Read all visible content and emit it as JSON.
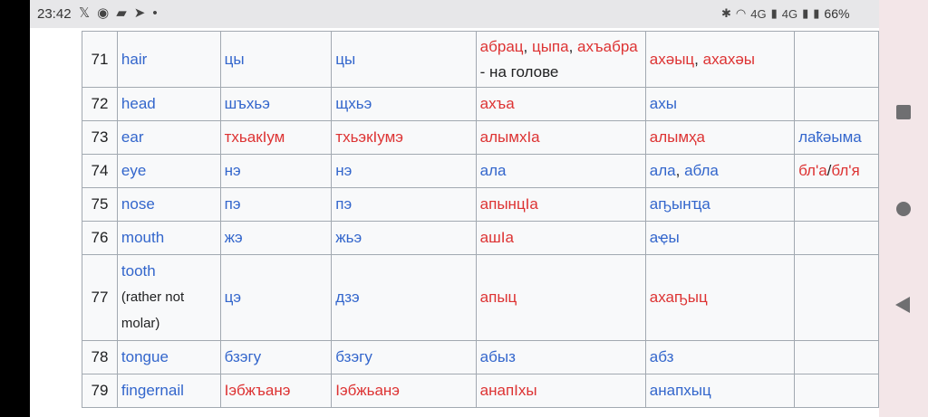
{
  "status": {
    "time": "23:42",
    "left_icons": [
      "x-icon",
      "telegram-icon",
      "chat-icon",
      "send-icon",
      "dot-icon"
    ],
    "battery": "66%",
    "net1": "4G",
    "net2": "4G"
  },
  "table": {
    "rows": [
      {
        "num": "71",
        "english": "hair",
        "c2": [
          {
            "t": "цы",
            "c": "blue"
          }
        ],
        "c3": [
          {
            "t": "цы",
            "c": "blue"
          }
        ],
        "c4": [
          {
            "t": "абрац",
            "c": "red"
          },
          {
            "t": ", ",
            "c": "blk"
          },
          {
            "t": "цыпа",
            "c": "red"
          },
          {
            "t": ", ",
            "c": "blk"
          },
          {
            "t": "ахъабра",
            "c": "red"
          },
          {
            "t": "- на голове",
            "c": "blk",
            "br": true
          }
        ],
        "c5": [
          {
            "t": "ахәыц",
            "c": "red"
          },
          {
            "t": ", ",
            "c": "blk"
          },
          {
            "t": "ахахәы",
            "c": "red"
          }
        ],
        "c6": []
      },
      {
        "num": "72",
        "english": "head",
        "c2": [
          {
            "t": "шъхьэ",
            "c": "blue"
          }
        ],
        "c3": [
          {
            "t": "щхьэ",
            "c": "blue"
          }
        ],
        "c4": [
          {
            "t": "ахъа",
            "c": "red"
          }
        ],
        "c5": [
          {
            "t": "ахы",
            "c": "blue"
          }
        ],
        "c6": []
      },
      {
        "num": "73",
        "english": "ear",
        "c2": [
          {
            "t": "тхьакӀум",
            "c": "red"
          }
        ],
        "c3": [
          {
            "t": "тхьэкӀумэ",
            "c": "red"
          }
        ],
        "c4": [
          {
            "t": "алымхӀа",
            "c": "red"
          }
        ],
        "c5": [
          {
            "t": "алымҳа",
            "c": "red"
          }
        ],
        "c6": [
          {
            "t": "лаҟәыма",
            "c": "blue"
          }
        ]
      },
      {
        "num": "74",
        "english": "eye",
        "c2": [
          {
            "t": "нэ",
            "c": "blue"
          }
        ],
        "c3": [
          {
            "t": "нэ",
            "c": "blue"
          }
        ],
        "c4": [
          {
            "t": "ала",
            "c": "blue"
          }
        ],
        "c5": [
          {
            "t": "ала",
            "c": "blue"
          },
          {
            "t": ", ",
            "c": "blk"
          },
          {
            "t": "абла",
            "c": "blue"
          }
        ],
        "c6": [
          {
            "t": "бл'а",
            "c": "red"
          },
          {
            "t": "/",
            "c": "blk"
          },
          {
            "t": "бл'я",
            "c": "red"
          }
        ]
      },
      {
        "num": "75",
        "english": "nose",
        "c2": [
          {
            "t": "пэ",
            "c": "blue"
          }
        ],
        "c3": [
          {
            "t": "пэ",
            "c": "blue"
          }
        ],
        "c4": [
          {
            "t": "апынцӀа",
            "c": "red"
          }
        ],
        "c5": [
          {
            "t": "аҧынҵа",
            "c": "blue"
          }
        ],
        "c6": []
      },
      {
        "num": "76",
        "english": "mouth",
        "c2": [
          {
            "t": "жэ",
            "c": "blue"
          }
        ],
        "c3": [
          {
            "t": "жьэ",
            "c": "blue"
          }
        ],
        "c4": [
          {
            "t": "ашӀа",
            "c": "red"
          }
        ],
        "c5": [
          {
            "t": "аҿы",
            "c": "blue"
          }
        ],
        "c6": []
      },
      {
        "num": "77",
        "english": "tooth",
        "english_note": "(rather not molar)",
        "c2": [
          {
            "t": "цэ",
            "c": "blue"
          }
        ],
        "c3": [
          {
            "t": "дзэ",
            "c": "blue"
          }
        ],
        "c4": [
          {
            "t": "апыц",
            "c": "red"
          }
        ],
        "c5": [
          {
            "t": "ахаҧыц",
            "c": "red"
          }
        ],
        "c6": []
      },
      {
        "num": "78",
        "english": "tongue",
        "c2": [
          {
            "t": "бзэгу",
            "c": "blue"
          }
        ],
        "c3": [
          {
            "t": "бзэгу",
            "c": "blue"
          }
        ],
        "c4": [
          {
            "t": "абыз",
            "c": "blue"
          }
        ],
        "c5": [
          {
            "t": "абз",
            "c": "blue"
          }
        ],
        "c6": []
      },
      {
        "num": "79",
        "english": "fingernail",
        "c2": [
          {
            "t": "Ӏэбжъанэ",
            "c": "red"
          }
        ],
        "c3": [
          {
            "t": "Ӏэбжьанэ",
            "c": "red"
          }
        ],
        "c4": [
          {
            "t": "анапӀхы",
            "c": "red"
          }
        ],
        "c5": [
          {
            "t": "анапхыц",
            "c": "blue"
          }
        ],
        "c6": []
      }
    ]
  },
  "nav": {
    "recents": "recents-square-icon",
    "home": "home-circle-icon",
    "back": "back-triangle-icon"
  }
}
